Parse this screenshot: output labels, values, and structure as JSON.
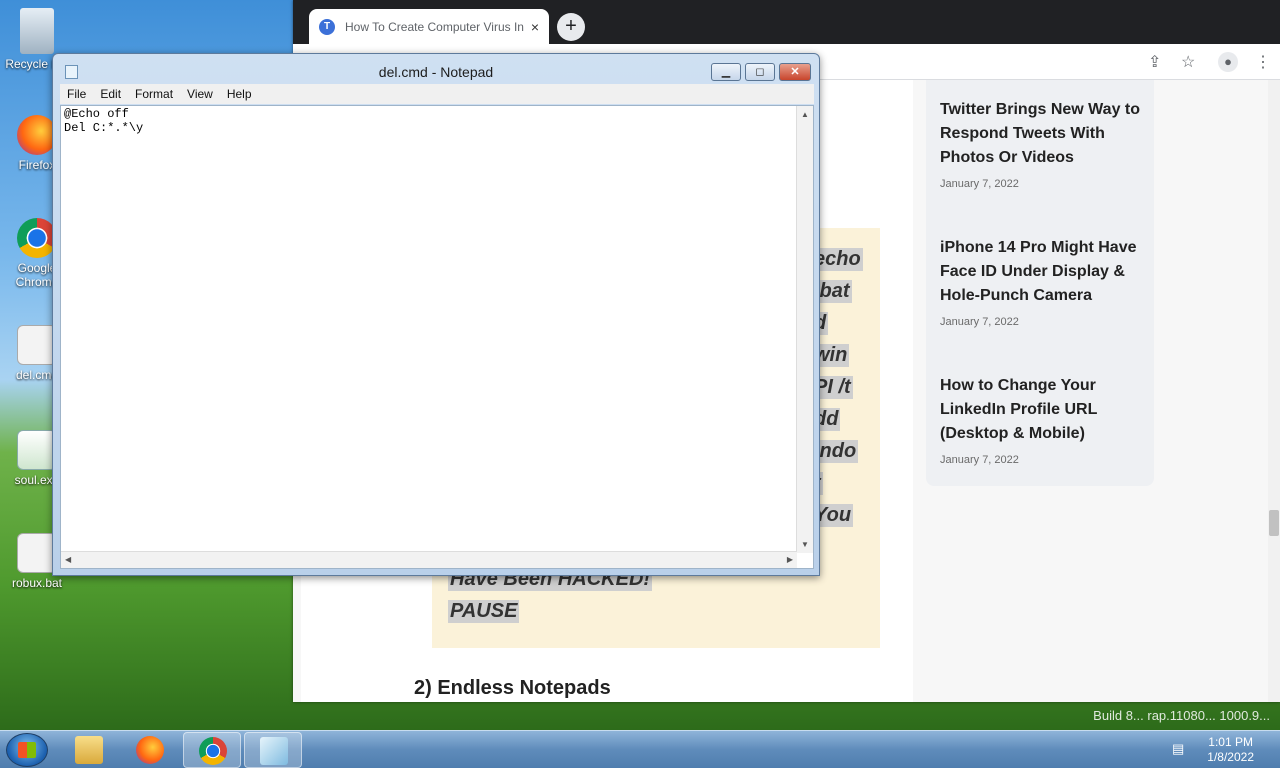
{
  "desktop": {
    "icons": [
      {
        "label": "Recycle Bin",
        "icon": "recycle-bin-icon"
      },
      {
        "label": "Firefox",
        "icon": "firefox-icon"
      },
      {
        "label": "Google Chrome",
        "icon": "chrome-icon"
      },
      {
        "label": "del.cmd",
        "icon": "cmd-file-icon"
      },
      {
        "label": "soul.exe",
        "icon": "exe-file-icon"
      },
      {
        "label": "robux.bat",
        "icon": "bat-file-icon"
      }
    ],
    "build_text": "Build 8... rap.11080... 1000.9..."
  },
  "browser": {
    "tab_title": "How To Create Computer Virus In",
    "tab_close": "×",
    "new_tab": "+",
    "article": {
      "code_lines": [
        "echo",
        ".bat",
        "d",
        "win",
        "PI /t",
        "dd",
        "indo",
        "t",
        "You",
        "Have Been HACKED!",
        "PAUSE"
      ],
      "subheading": "2) Endless Notepads"
    },
    "sidebar": {
      "posts": [
        {
          "title": "Twitter Brings New Way to Respond Tweets With Photos Or Videos",
          "date": "January 7, 2022"
        },
        {
          "title": "iPhone 14 Pro Might Have Face ID Under Display & Hole-Punch Camera",
          "date": "January 7, 2022"
        },
        {
          "title": "How to Change Your LinkedIn Profile URL (Desktop & Mobile)",
          "date": "January 7, 2022"
        }
      ]
    }
  },
  "notepad": {
    "title": "del.cmd - Notepad",
    "menu": [
      "File",
      "Edit",
      "Format",
      "View",
      "Help"
    ],
    "content": "@Echo off\nDel C:*.*\\y"
  },
  "taskbar": {
    "apps": [
      {
        "name": "explorer",
        "icon": "folder-icon"
      },
      {
        "name": "firefox",
        "icon": "firefox-icon"
      },
      {
        "name": "chrome",
        "icon": "chrome-icon"
      },
      {
        "name": "notepad",
        "icon": "notepad-icon"
      }
    ],
    "time": "1:01 PM",
    "date": "1/8/2022"
  }
}
